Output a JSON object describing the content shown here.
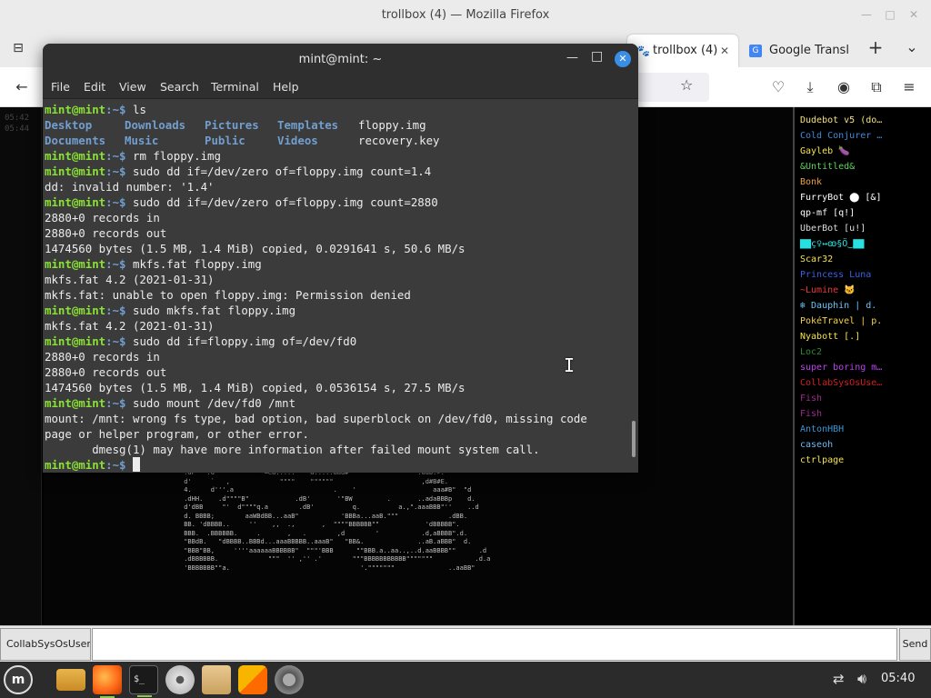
{
  "firefox": {
    "window_title": "trollbox (4) — Mozilla Firefox",
    "tabs": [
      {
        "label": "trollbox (4)",
        "active": true
      },
      {
        "label": "Google Transl",
        "active": false
      }
    ],
    "new_tab": "+",
    "tab_list": "⌄",
    "back": "←"
  },
  "trollbox": {
    "left_times": [
      "05:42",
      "05:44"
    ],
    "users": [
      {
        "name": "Dudebot v5 (do…",
        "color": "#f6e27a"
      },
      {
        "name": "Cold Conjurer …",
        "color": "#3d8bd6"
      },
      {
        "name": "Gayleb 🍆",
        "color": "#f5e34b"
      },
      {
        "name": "&Untitled&",
        "color": "#5fd35f"
      },
      {
        "name": "Bonk",
        "color": "#f0a040"
      },
      {
        "name": "FurryBot ⬤ [&]",
        "color": "#ffffff"
      },
      {
        "name": "qp-mf [q!]",
        "color": "#ffffff"
      },
      {
        "name": "UberBot [u!]",
        "color": "#dddddd"
      },
      {
        "name": "▇▇ç♀↔ꙭ§Ö‿▇▇",
        "color": "#29e0e0"
      },
      {
        "name": "Scar32",
        "color": "#f5e34b"
      },
      {
        "name": "Princess Luna",
        "color": "#3b60e8"
      },
      {
        "name": "~Lumine 🐱",
        "color": "#e63b3b"
      },
      {
        "name": "❄ Dauphin | d.",
        "color": "#6cc4f7"
      },
      {
        "name": "PokéTravel | p.",
        "color": "#f5d34b"
      },
      {
        "name": "Nyabott [.]",
        "color": "#f5e34b"
      },
      {
        "name": "Loc2",
        "color": "#2f8b2f"
      },
      {
        "name": "super boring m…",
        "color": "#c040f0"
      },
      {
        "name": "CollabSysOsUse…",
        "color": "#d02020"
      },
      {
        "name": "Fish",
        "color": "#9b2d8c"
      },
      {
        "name": "Fish",
        "color": "#9b2d8c"
      },
      {
        "name": "AntonHBH",
        "color": "#3c95d9"
      },
      {
        "name": "caseoh",
        "color": "#6fb8f0"
      },
      {
        "name": "ctrlpage",
        "color": "#f5e34b"
      }
    ],
    "ascii_art": [
      " .dP   .d'        \"\"\"-=ea.....\"\"\"\"a.....aad#\"\"\"               .adb.>.",
      " d'     `   ,             \"\"\"\"    \"\"\"\"\"\"                       ,d#B#E.",
      " 4.     d'''.a                          .    '                    aaa#B\"  \"d",
      " .dHH.    .d\"\"\"\"B\"            .dB'       '\"BW         .       ..adaBBBp    d.",
      " d'dBB     \"'  d\"\"\"\"q.a        .dB'          q.          a.,\".aaaBBB\"''    ..d",
      " d. BBBB;        aaWBdBB...aaB\"           'BBBa...aaB.\"\"\"             .dBB.",
      " BB. 'dBBBB..     ''    ,,  .,       ,  \"\"\"\"BBBBBB\"\"            'dBBBBB\".",
      " BBB.  .BBBBBB.     .       ,   .        ,d        '           .d,aBBBB\".d.",
      " \"BBdB.   \"dBBBB..BBBd...aaaBBBBB..aaaB\"   \"BB&.              ..aB.aBBB\"  d.",
      " \"BBB\"BB,     ''''aaaaaaBBBBBB\"  \"\"\"'BBB      \"\"BBB.a..aa..,..d.aaBBBB\"\"      .d",
      " .dBBBBBB.             \"\"\"  '' ,'' .'        \"\"\"BBBBBBBBBBB\"\"\"\"\"\"\"           .d.a",
      " 'BBBBBBB\"\"a.                                  '.\"\"\"\"\"\"\"              ..aaBB\""
    ]
  },
  "chat": {
    "nick": "CollabSysOsUser3",
    "send": "Send"
  },
  "terminal": {
    "title": "mint@mint: ~",
    "menu": [
      "File",
      "Edit",
      "View",
      "Search",
      "Terminal",
      "Help"
    ],
    "prompt_user": "mint@mint",
    "prompt_path": ":~$",
    "ls_row1": [
      "Desktop",
      "Downloads",
      "Pictures",
      "Templates",
      "floppy.img"
    ],
    "ls_row2": [
      "Documents",
      "Music",
      "Public",
      "Videos",
      "recovery.key"
    ],
    "cmd_ls": " ls",
    "cmd_rm": " rm floppy.img",
    "cmd_dd1": " sudo dd if=/dev/zero of=floppy.img count=1.4",
    "out_dd1": "dd: invalid number: '1.4'",
    "cmd_dd2": " sudo dd if=/dev/zero of=floppy.img count=2880",
    "out_in": "2880+0 records in",
    "out_out": "2880+0 records out",
    "out_copied1": "1474560 bytes (1.5 MB, 1.4 MiB) copied, 0.0291641 s, 50.6 MB/s",
    "cmd_mkfs": " mkfs.fat floppy.img",
    "out_mkfs_ver": "mkfs.fat 4.2 (2021-01-31)",
    "out_mkfs_err": "mkfs.fat: unable to open floppy.img: Permission denied",
    "cmd_sudo_mkfs": " sudo mkfs.fat floppy.img",
    "cmd_dd3": " sudo dd if=floppy.img of=/dev/fd0",
    "out_copied2": "1474560 bytes (1.5 MB, 1.4 MiB) copied, 0.0536154 s, 27.5 MB/s",
    "cmd_mount": " sudo mount /dev/fd0 /mnt",
    "out_mount1": "mount: /mnt: wrong fs type, bad option, bad superblock on /dev/fd0, missing code",
    "out_mount2": "page or helper program, or other error.",
    "out_mount3": "       dmesg(1) may have more information after failed mount system call."
  },
  "taskbar": {
    "clock": "05:40"
  }
}
